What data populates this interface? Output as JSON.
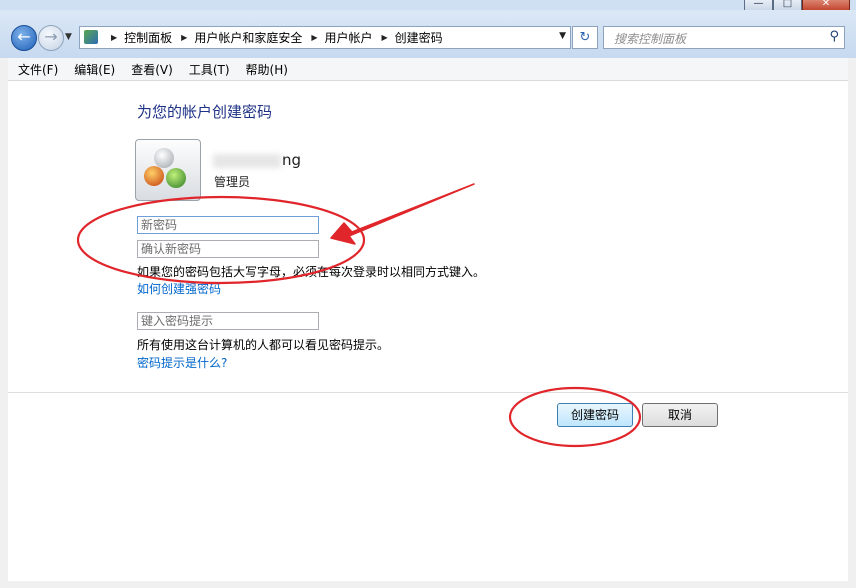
{
  "window": {
    "controls": [
      "minimize",
      "maximize",
      "close"
    ]
  },
  "nav": {
    "back_icon": "back-arrow-icon",
    "forward_icon": "forward-arrow-icon"
  },
  "address": {
    "icon": "control-panel-icon",
    "breadcrumbs": [
      "控制面板",
      "用户帐户和家庭安全",
      "用户帐户",
      "创建密码"
    ]
  },
  "search": {
    "placeholder": "搜索控制面板"
  },
  "menu": {
    "items": [
      "文件(F)",
      "编辑(E)",
      "查看(V)",
      "工具(T)",
      "帮助(H)"
    ]
  },
  "page": {
    "title": "为您的帐户创建密码",
    "user": {
      "name_suffix": "ng",
      "role": "管理员"
    },
    "new_password_placeholder": "新密码",
    "confirm_password_placeholder": "确认新密码",
    "case_note": "如果您的密码包括大写字母，必须在每次登录时以相同方式键入。",
    "strong_password_link": "如何创建强密码",
    "hint_placeholder": "键入密码提示",
    "hint_note": "所有使用这台计算机的人都可以看见密码提示。",
    "hint_link": "密码提示是什么?",
    "create_button": "创建密码",
    "cancel_button": "取消"
  },
  "annotation_color": "#e0262b"
}
